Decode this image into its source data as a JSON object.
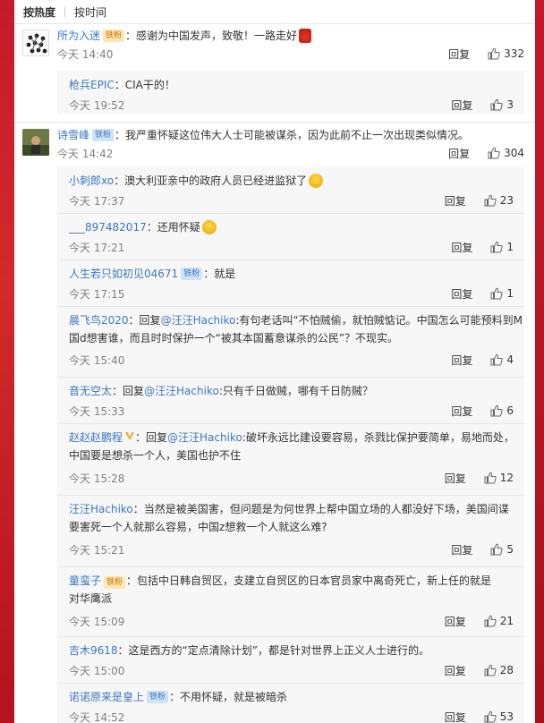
{
  "sort": {
    "hot": "按热度",
    "time": "按时间"
  },
  "actions": {
    "reply": "回复"
  },
  "c1": {
    "user": "所为入迷",
    "badge": "铁粉",
    "text": "：感谢为中国发声，致敬！一路走好",
    "time": "今天 14:40",
    "likes": "332"
  },
  "c1r1": {
    "user": "枪兵EPIC",
    "text": "：CIA干的！",
    "time": "今天 19:52",
    "likes": "3"
  },
  "c2": {
    "user": "诗雪峰",
    "badge": "铁粉",
    "text": "：我严重怀疑这位伟大人士可能被谋杀，因为此前不止一次出现类似情况。",
    "time": "今天 14:42",
    "likes": "304"
  },
  "r1": {
    "user": "小刺郎xo",
    "text": "：澳大利亚亲中的政府人员已经进监狱了",
    "time": "今天 17:37",
    "likes": "23"
  },
  "r2": {
    "user": "___897482017",
    "text": "：还用怀疑",
    "time": "今天 17:21",
    "likes": "1"
  },
  "r3": {
    "user": "人生若只如初见04671",
    "badge": "铁粉",
    "text": "：就是",
    "time": "今天 17:15",
    "likes": "1"
  },
  "r4": {
    "user": "晨飞鸟2020",
    "pre": "：回复",
    "mention": "@汪汪Hachiko",
    "text1": ":有句老话叫“不怕贼偷，就怕贼惦记。中国怎么可能预料到M",
    "text2": "国d想害谁，而且时时保护一个“被其本国蓄意谋杀的公民”？不现实。",
    "time": "今天 15:40",
    "likes": "4"
  },
  "r5": {
    "user": "音无空太",
    "pre": "：回复",
    "mention": "@汪汪Hachiko",
    "text1": ":只有千日做贼，哪有千日防贼？",
    "time": "今天 15:33",
    "likes": "6"
  },
  "r6": {
    "user": "赵赵赵鹏程",
    "pre": "：回复",
    "mention": "@汪汪Hachiko",
    "text1": ":破坏永远比建设要容易，杀戮比保护要简单，易地而处，",
    "text2": "中国要是想杀一个人，美国也护不住",
    "time": "今天 15:28",
    "likes": "12"
  },
  "r7": {
    "user": "汪汪Hachiko",
    "text1": "：当然是被美国害，但问题是为何世界上帮中国立场的人都没好下场，美国间谍",
    "text2": "要害死一个人就那么容易，中国z想救一个人就这么难?",
    "time": "今天 15:21",
    "likes": "5"
  },
  "r8": {
    "user": "童蛮子",
    "badge": "铁粉",
    "text1": "：包括中日韩自贸区，支建立自贸区的日本官员家中离奇死亡，新上任的就是",
    "text2": "对华鹰派",
    "time": "今天 15:09",
    "likes": "21"
  },
  "r9": {
    "user": "吉木9618",
    "text1": "：这是西方的“定点清除计划”，都是针对世界上正义人士进行的。",
    "time": "今天 15:00",
    "likes": "28"
  },
  "r10": {
    "user": "诺诺原来是皇上",
    "badge": "铁粉",
    "text1": "：不用怀疑，就是被暗杀",
    "time": "今天 14:52",
    "likes": "53"
  },
  "colors": {
    "bg": "#c8102e",
    "link": "#3a78c3",
    "orange": "#eb7350"
  },
  "icons": {
    "like": "thumbs-up-icon",
    "verified": "v-verified-icon"
  }
}
